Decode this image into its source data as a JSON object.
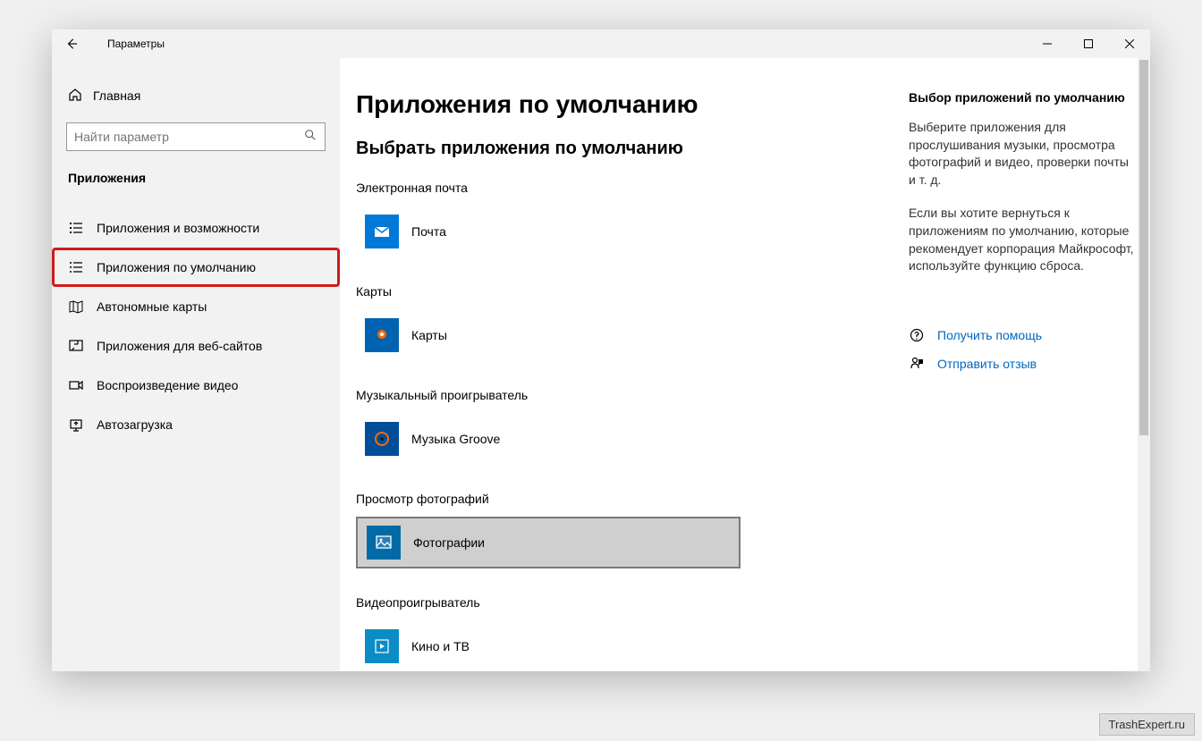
{
  "window": {
    "title": "Параметры"
  },
  "sidebar": {
    "home": "Главная",
    "search_placeholder": "Найти параметр",
    "section": "Приложения",
    "items": [
      {
        "label": "Приложения и возможности"
      },
      {
        "label": "Приложения по умолчанию"
      },
      {
        "label": "Автономные карты"
      },
      {
        "label": "Приложения для веб-сайтов"
      },
      {
        "label": "Воспроизведение видео"
      },
      {
        "label": "Автозагрузка"
      }
    ]
  },
  "main": {
    "heading": "Приложения по умолчанию",
    "subheading": "Выбрать приложения по умолчанию",
    "categories": [
      {
        "label": "Электронная почта",
        "app": "Почта"
      },
      {
        "label": "Карты",
        "app": "Карты"
      },
      {
        "label": "Музыкальный проигрыватель",
        "app": "Музыка Groove"
      },
      {
        "label": "Просмотр фотографий",
        "app": "Фотографии"
      },
      {
        "label": "Видеопроигрыватель",
        "app": "Кино и ТВ"
      }
    ]
  },
  "aside": {
    "heading": "Выбор приложений по умолчанию",
    "p1": "Выберите приложения для прослушивания музыки, просмотра фотографий и видео, проверки почты и т. д.",
    "p2": "Если вы хотите вернуться к приложениям по умолчанию, которые рекомендует корпорация Майкрософт, используйте функцию сброса.",
    "help": "Получить помощь",
    "feedback": "Отправить отзыв"
  },
  "watermark": "TrashExpert.ru"
}
